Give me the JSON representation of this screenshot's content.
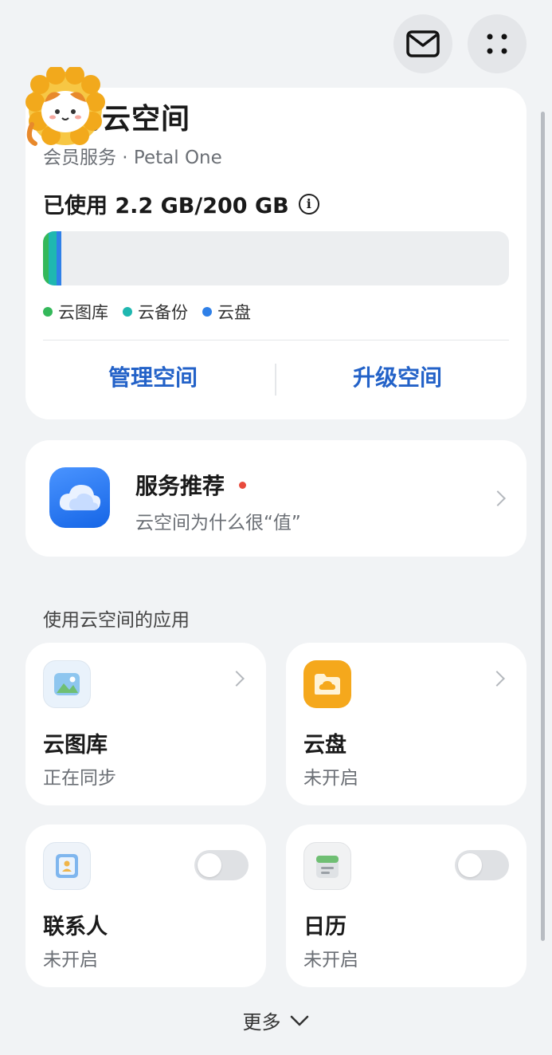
{
  "header": {
    "mail_icon": "mail-icon",
    "more_icon": "grid-dots-icon"
  },
  "storage": {
    "title": "我的云空间",
    "subtitle": "会员服务 · Petal One",
    "used_label": "已使用 2.2 GB/200 GB",
    "usage": {
      "used_gb": 2.2,
      "total_gb": 200
    },
    "legend": [
      {
        "label": "云图库",
        "color": "#34b85a"
      },
      {
        "label": "云备份",
        "color": "#1fb7b0"
      },
      {
        "label": "云盘",
        "color": "#2f80e8"
      }
    ],
    "manage_label": "管理空间",
    "upgrade_label": "升级空间"
  },
  "service": {
    "title": "服务推荐",
    "subtitle": "云空间为什么很“值”"
  },
  "apps_section": {
    "title": "使用云空间的应用",
    "apps": [
      {
        "name": "云图库",
        "status": "正在同步"
      },
      {
        "name": "云盘",
        "status": "未开启"
      },
      {
        "name": "联系人",
        "status": "未开启",
        "toggle_on": false
      },
      {
        "name": "日历",
        "status": "未开启",
        "toggle_on": false
      }
    ]
  },
  "footer": {
    "more_label": "更多"
  },
  "colors": {
    "accent": "#2362c8",
    "badge": "#e84a3d"
  }
}
